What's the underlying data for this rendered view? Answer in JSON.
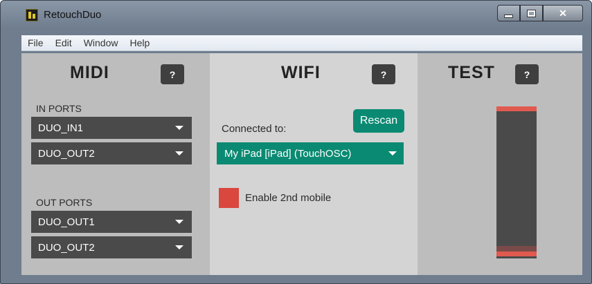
{
  "window": {
    "title": "RetouchDuo"
  },
  "menu": {
    "file": "File",
    "edit": "Edit",
    "window": "Window",
    "help": "Help"
  },
  "midi": {
    "title": "MIDI",
    "help_label": "?",
    "in_ports_label": "IN PORTS",
    "in_ports": [
      "DUO_IN1",
      "DUO_OUT2"
    ],
    "out_ports_label": "OUT PORTS",
    "out_ports": [
      "DUO_OUT1",
      "DUO_OUT2"
    ]
  },
  "wifi": {
    "title": "WIFI",
    "help_label": "?",
    "connected_label": "Connected to:",
    "rescan_label": "Rescan",
    "device": "My iPad [iPad] (TouchOSC)",
    "enable_second_label": "Enable 2nd mobile"
  },
  "test": {
    "title": "TEST",
    "help_label": "?"
  },
  "colors": {
    "accent": "#0b8a73",
    "warning": "#d9473f",
    "dropdown": "#4a4a4a"
  }
}
